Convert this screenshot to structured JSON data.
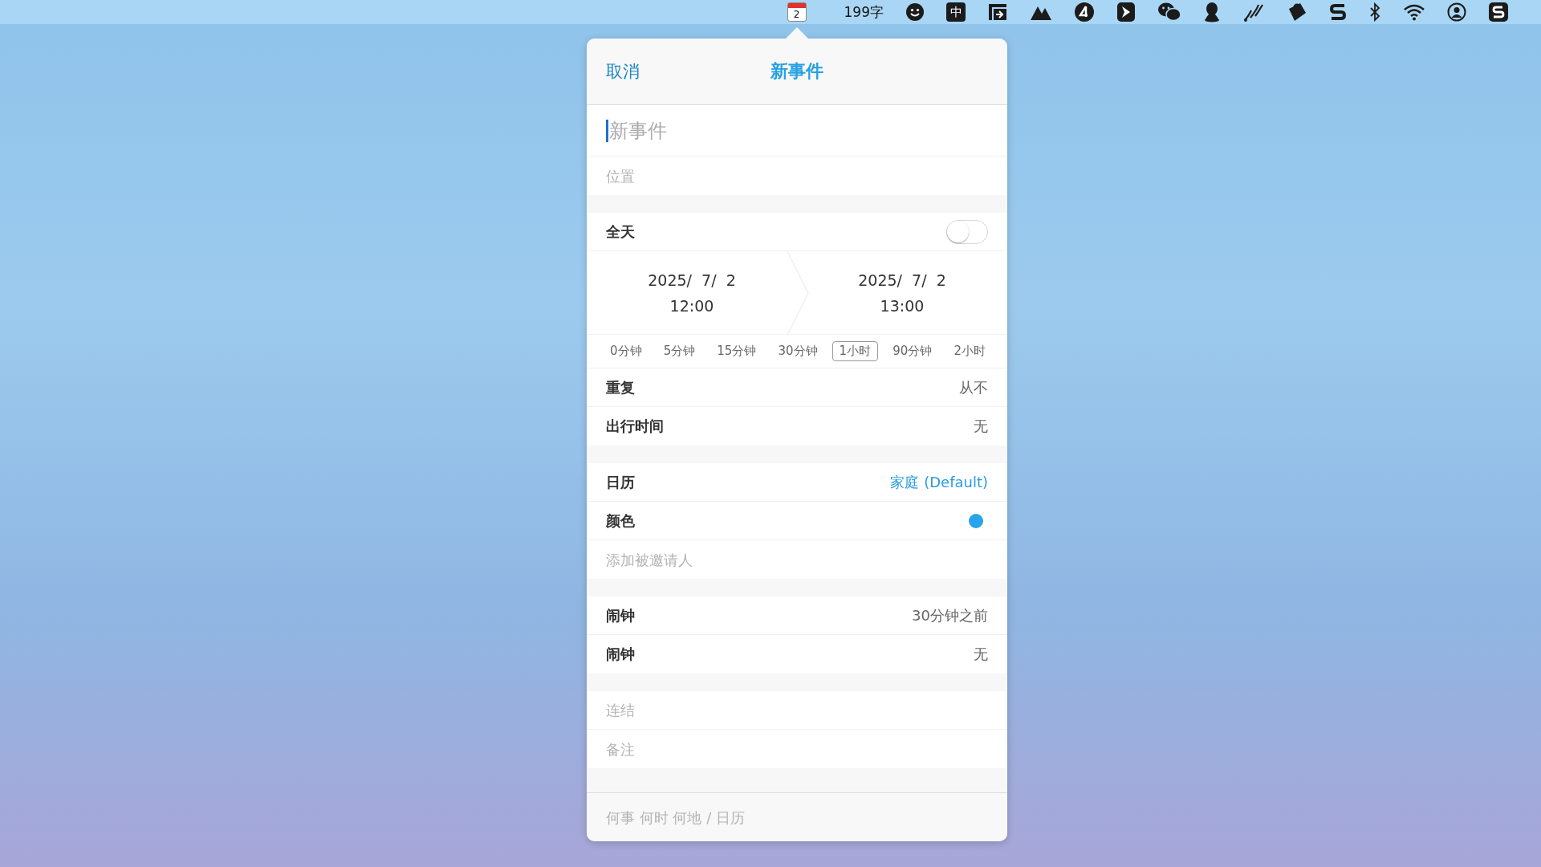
{
  "menu_bar": {
    "calendar_day": "2",
    "word_count": "199字",
    "input_method": "中"
  },
  "popover": {
    "cancel": "取消",
    "title": "新事件",
    "sections": [
      {
        "rows": [
          {
            "kind": "title_field",
            "placeholder": "新事件",
            "focused": true
          },
          {
            "kind": "field",
            "placeholder": "位置"
          }
        ]
      },
      {
        "rows": [
          {
            "kind": "toggle",
            "label": "全天",
            "on": false
          },
          {
            "kind": "dates",
            "start": {
              "date": "2025/  7/  2",
              "time": "12:00"
            },
            "end": {
              "date": "2025/  7/  2",
              "time": "13:00"
            }
          },
          {
            "kind": "durations",
            "options": [
              {
                "label": "0分钟",
                "selected": false
              },
              {
                "label": "5分钟",
                "selected": false
              },
              {
                "label": "15分钟",
                "selected": false
              },
              {
                "label": "30分钟",
                "selected": false
              },
              {
                "label": "1小时",
                "selected": true
              },
              {
                "label": "90分钟",
                "selected": false
              },
              {
                "label": "2小时",
                "selected": false
              }
            ]
          },
          {
            "kind": "value",
            "label": "重复",
            "value": "从不"
          },
          {
            "kind": "value",
            "label": "出行时间",
            "value": "无"
          }
        ]
      },
      {
        "rows": [
          {
            "kind": "link",
            "label": "日历",
            "value": "家庭 (Default)"
          },
          {
            "kind": "color",
            "label": "颜色",
            "color": "#29a3ec"
          },
          {
            "kind": "field",
            "placeholder": "添加被邀请人"
          }
        ]
      },
      {
        "rows": [
          {
            "kind": "value",
            "label": "闹钟",
            "value": "30分钟之前"
          },
          {
            "kind": "value",
            "label": "闹钟",
            "value": "无"
          }
        ]
      },
      {
        "rows": [
          {
            "kind": "field",
            "placeholder": "连结"
          },
          {
            "kind": "field",
            "placeholder": "备注"
          }
        ]
      }
    ],
    "footer": {
      "placeholder": "何事 何时 何地 / 日历"
    }
  }
}
